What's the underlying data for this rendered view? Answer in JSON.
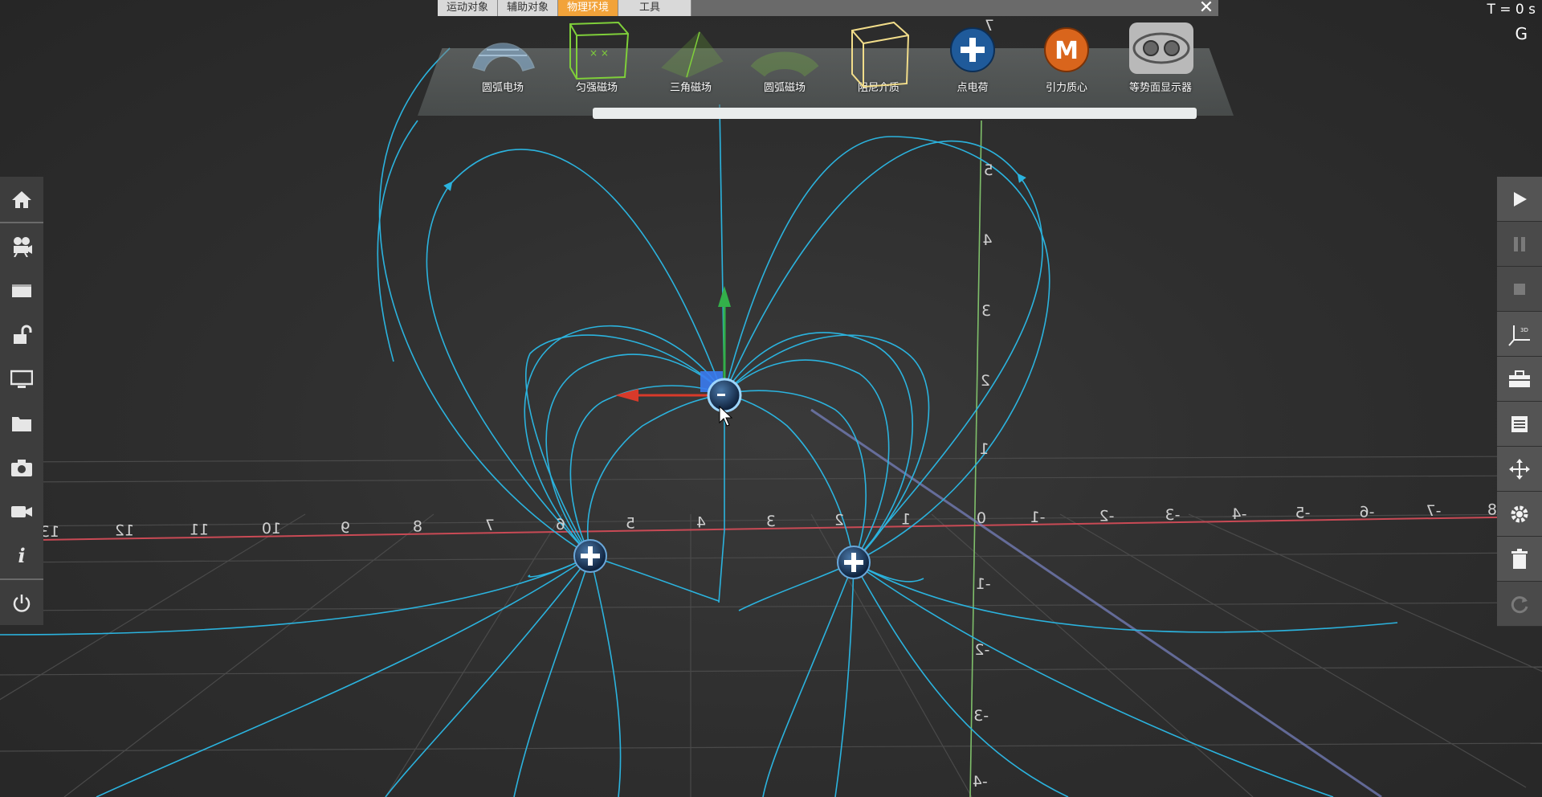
{
  "tabs": [
    {
      "label": "运动对象",
      "active": false
    },
    {
      "label": "辅助对象",
      "active": false
    },
    {
      "label": "物理环境",
      "active": true
    },
    {
      "label": "工具",
      "active": false
    }
  ],
  "close_icon": "close-icon",
  "tools": [
    {
      "label": "圆弧电场",
      "icon": "arc-electric-field-icon"
    },
    {
      "label": "匀强磁场",
      "icon": "uniform-magnetic-field-icon"
    },
    {
      "label": "三角磁场",
      "icon": "triangle-magnetic-field-icon"
    },
    {
      "label": "圆弧磁场",
      "icon": "arc-magnetic-field-icon"
    },
    {
      "label": "阻尼介质",
      "icon": "damping-medium-icon"
    },
    {
      "label": "点电荷",
      "icon": "point-charge-icon"
    },
    {
      "label": "引力质心",
      "icon": "gravity-center-icon"
    },
    {
      "label": "等势面显示器",
      "icon": "equipotential-display-icon"
    }
  ],
  "status": {
    "time": "T = 0 s",
    "gravity_key": "G"
  },
  "left_sidebar": [
    "home-icon",
    "camera-rig-icon",
    "window-icon",
    "unlock-icon",
    "monitor-icon",
    "folder-icon",
    "photo-camera-icon",
    "video-camera-icon",
    "info-icon",
    "power-icon"
  ],
  "right_sidebar": [
    "play-icon",
    "pause-icon",
    "stop-icon",
    "axes-icon",
    "toolbox-icon",
    "list-icon",
    "move-icon",
    "gear-icon",
    "trash-icon",
    "reset-icon"
  ],
  "axis_x_ticks": [
    "13",
    "12",
    "11",
    "10",
    "9",
    "8",
    "7",
    "6",
    "5",
    "4",
    "3",
    "2",
    "1",
    "0",
    "-1",
    "-2",
    "-3",
    "-4",
    "-5",
    "-6",
    "-7",
    "8"
  ],
  "axis_y_ticks": [
    "7",
    "5",
    "4",
    "3",
    "2",
    "1",
    "-1",
    "-2",
    "-3",
    "-4"
  ],
  "charges": [
    {
      "sign": "+",
      "name": "positive-charge-left"
    },
    {
      "sign": "+",
      "name": "positive-charge-right"
    },
    {
      "sign": "-",
      "name": "negative-charge-selected"
    }
  ],
  "colors": {
    "field_line": "#2bb3de",
    "x_axis": "#c94a55",
    "y_axis": "#7fbf6a",
    "active_tab": "#f2a33a",
    "gizmo_x": "#d83a2a",
    "gizmo_y": "#33b04a",
    "gizmo_handle": "#3a7bf0"
  }
}
